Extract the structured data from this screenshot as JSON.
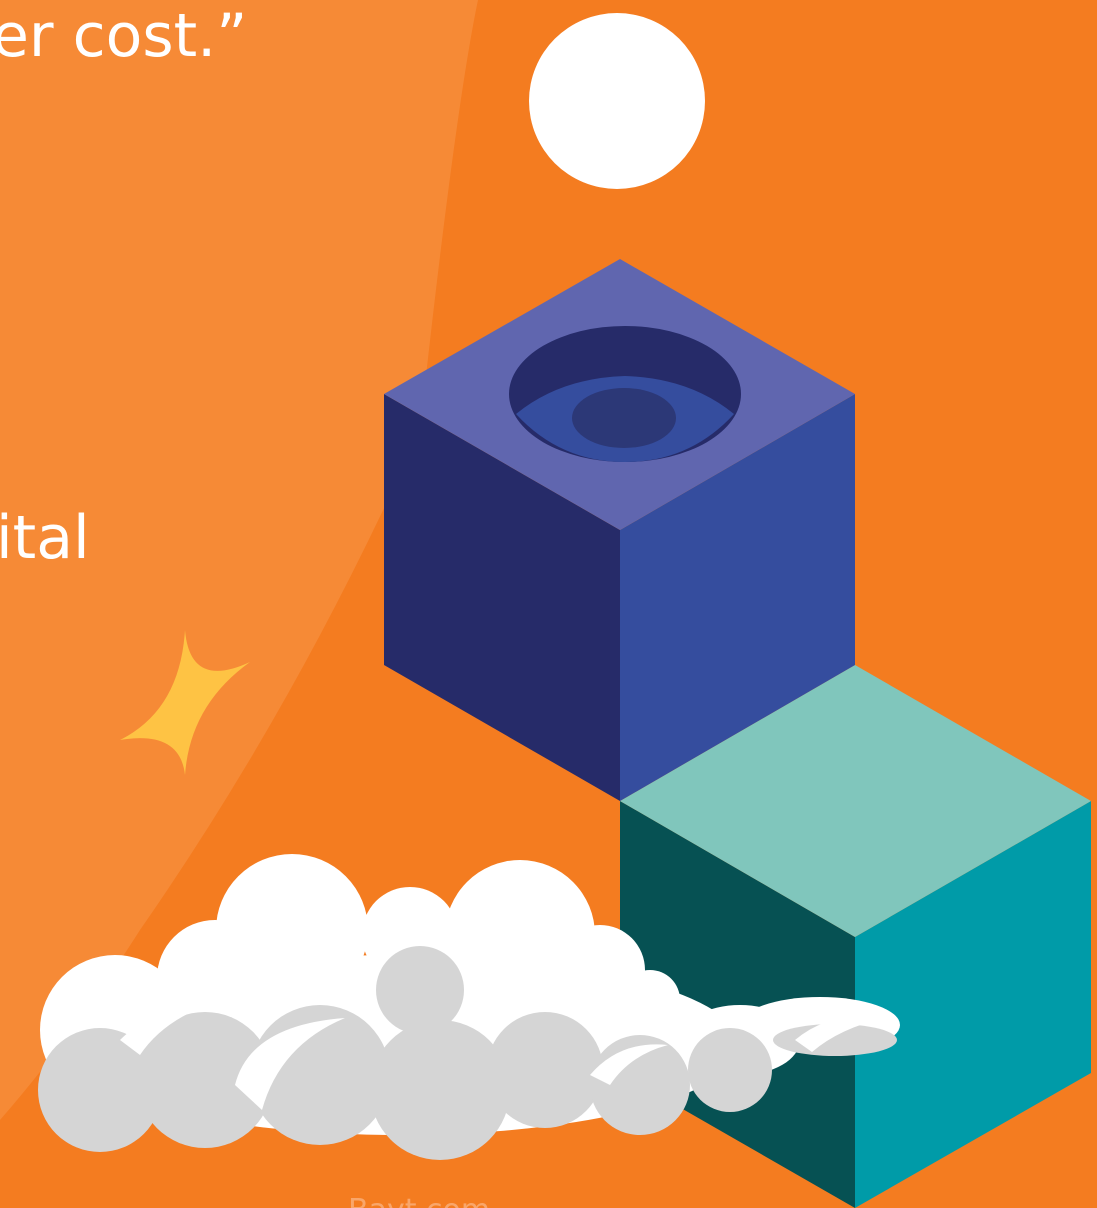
{
  "quote": {
    "line_1": "er cost.”",
    "line_2": "ital"
  },
  "footer": {
    "brand_text": "Bayt.com"
  },
  "icons": {
    "sun": "sun-circle-icon",
    "top_cube": "hollow-cube-icon",
    "bottom_cube": "solid-cube-icon",
    "sparkle": "four-point-star-icon",
    "cloud": "cloud-icon"
  },
  "colors": {
    "background": "#F47C20",
    "light_arc": "#F68A36",
    "sun": "#FFFFFF",
    "top_cube_top": "#6066AF",
    "top_cube_left": "#262B69",
    "top_cube_right": "#354D9E",
    "bottom_cube_top": "#80C6BC",
    "bottom_cube_left": "#065153",
    "bottom_cube_right": "#009BA8",
    "sparkle": "#FEC344",
    "cloud_light": "#FFFFFF",
    "cloud_shadow": "#D5D5D5"
  }
}
